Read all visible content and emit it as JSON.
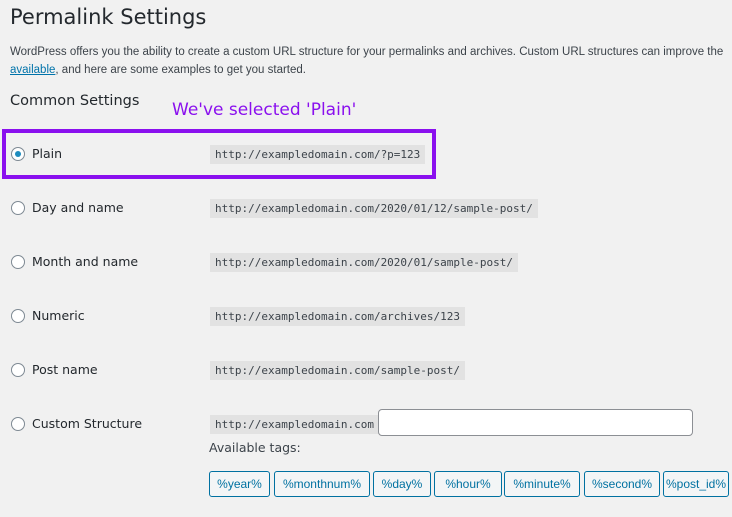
{
  "page_title": "Permalink Settings",
  "description": {
    "line1": "WordPress offers you the ability to create a custom URL structure for your permalinks and archives. Custom URL structures can improve the",
    "link": "available",
    "line2_rest": ", and here are some examples to get you started."
  },
  "section_title": "Common Settings",
  "annotation": "We've selected 'Plain'",
  "annotation_color": "#8a10ee",
  "options": [
    {
      "label": "Plain",
      "example": "http://exampledomain.com/?p=123",
      "selected": true
    },
    {
      "label": "Day and name",
      "example": "http://exampledomain.com/2020/01/12/sample-post/",
      "selected": false
    },
    {
      "label": "Month and name",
      "example": "http://exampledomain.com/2020/01/sample-post/",
      "selected": false
    },
    {
      "label": "Numeric",
      "example": "http://exampledomain.com/archives/123",
      "selected": false
    },
    {
      "label": "Post name",
      "example": "http://exampledomain.com/sample-post/",
      "selected": false
    },
    {
      "label": "Custom Structure",
      "example": "http://exampledomain.com",
      "selected": false
    }
  ],
  "custom_structure_value": "",
  "available_tags_label": "Available tags:",
  "tags": [
    "%year%",
    "%monthnum%",
    "%day%",
    "%hour%",
    "%minute%",
    "%second%",
    "%post_id%"
  ]
}
